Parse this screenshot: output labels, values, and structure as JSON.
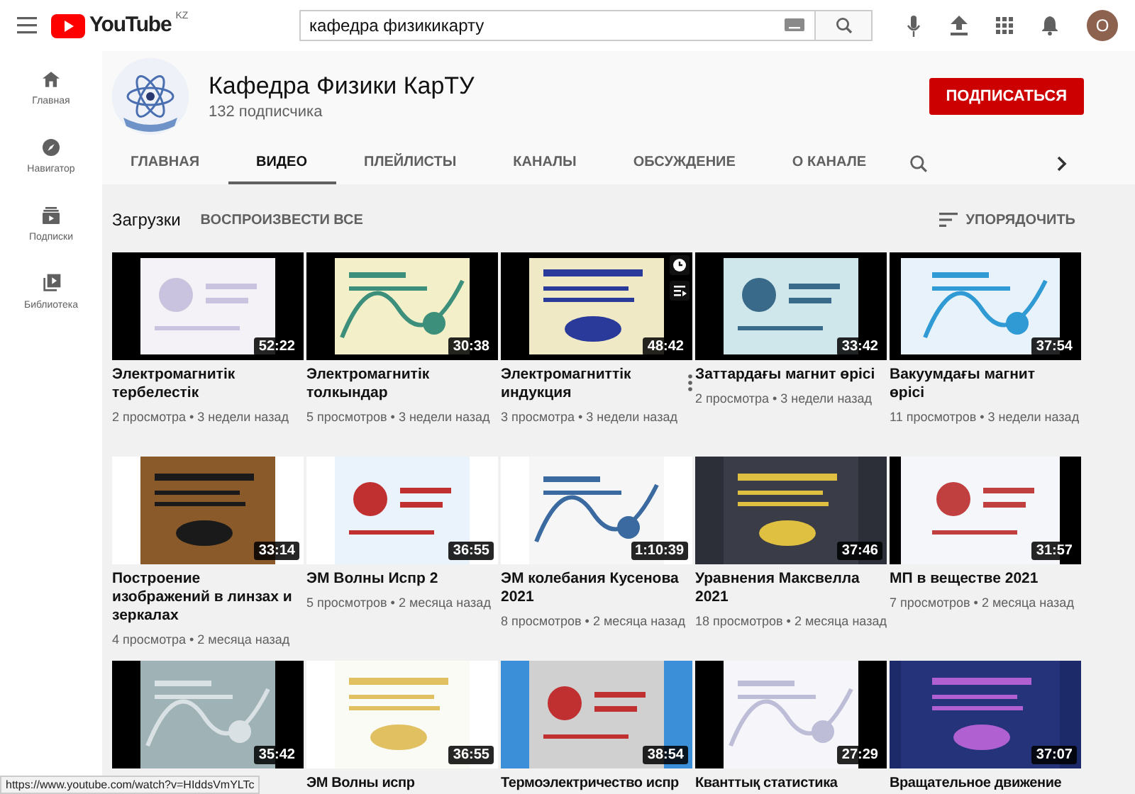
{
  "topbar": {
    "logo": "YouTube",
    "region": "KZ",
    "search": {
      "value": "кафедра физикикарту"
    },
    "avatar": "О"
  },
  "sidebar": {
    "items": [
      {
        "label": "Главная"
      },
      {
        "label": "Навигатор"
      },
      {
        "label": "Подписки"
      },
      {
        "label": "Библиотека"
      }
    ]
  },
  "channel": {
    "name": "Кафедра Физики КарТУ",
    "subscribers": "132 подписчика",
    "subscribe_button": "ПОДПИСАТЬСЯ"
  },
  "tabs": [
    {
      "label": "ГЛАВНАЯ",
      "selected": false
    },
    {
      "label": "ВИДЕО",
      "selected": true
    },
    {
      "label": "ПЛЕЙЛИСТЫ",
      "selected": false
    },
    {
      "label": "КАНАЛЫ",
      "selected": false
    },
    {
      "label": "ОБСУЖДЕНИЕ",
      "selected": false
    },
    {
      "label": "О КАНАЛЕ",
      "selected": false
    }
  ],
  "section": {
    "title": "Загрузки",
    "play_all": "ВОСПРОИЗВЕСТИ ВСЕ",
    "sort": "УПОРЯДОЧИТЬ"
  },
  "videos": [
    {
      "title": "Электромагнитік тербелестік",
      "duration": "52:22",
      "meta": "2 просмотра • 3 недели назад",
      "hovered": false
    },
    {
      "title": "Электромагнитік толкындар",
      "duration": "30:38",
      "meta": "5 просмотров • 3 недели назад",
      "hovered": false
    },
    {
      "title": "Электромагниттік индукция",
      "duration": "48:42",
      "meta": "3 просмотра • 3 недели назад",
      "hovered": true
    },
    {
      "title": "Заттардағы магнит өрісі",
      "duration": "33:42",
      "meta": "2 просмотра • 3 недели назад",
      "hovered": false
    },
    {
      "title": "Вакуумдағы магнит өрісі",
      "duration": "37:54",
      "meta": "11 просмотров • 3 недели назад",
      "hovered": false
    },
    {
      "title": "Построение изображений в линзах и зеркалах",
      "duration": "33:14",
      "meta": "4 просмотра • 2 месяца назад",
      "hovered": false
    },
    {
      "title": "ЭМ Волны Испр 2",
      "duration": "36:55",
      "meta": "5 просмотров • 2 месяца назад",
      "hovered": false
    },
    {
      "title": "ЭМ колебания Кусенова 2021",
      "duration": "1:10:39",
      "meta": "8 просмотров • 2 месяца назад",
      "hovered": false
    },
    {
      "title": "Уравнения Максвелла 2021",
      "duration": "37:46",
      "meta": "18 просмотров • 2 месяца назад",
      "hovered": false
    },
    {
      "title": "МП в веществе 2021",
      "duration": "31:57",
      "meta": "7 просмотров • 2 месяца назад",
      "hovered": false
    },
    {
      "duration": "35:42",
      "hovered": false
    },
    {
      "title": "ЭМ Волны испр",
      "duration": "36:55",
      "hovered": false
    },
    {
      "title": "Термоэлектричество испр",
      "duration": "38:54",
      "hovered": false
    },
    {
      "title": "Кванттық статистика",
      "duration": "27:29",
      "hovered": false
    },
    {
      "title": "Вращательное движение",
      "duration": "37:07",
      "hovered": false
    }
  ],
  "status_url": "https://www.youtube.com/watch?v=HIddsVmYLTc"
}
